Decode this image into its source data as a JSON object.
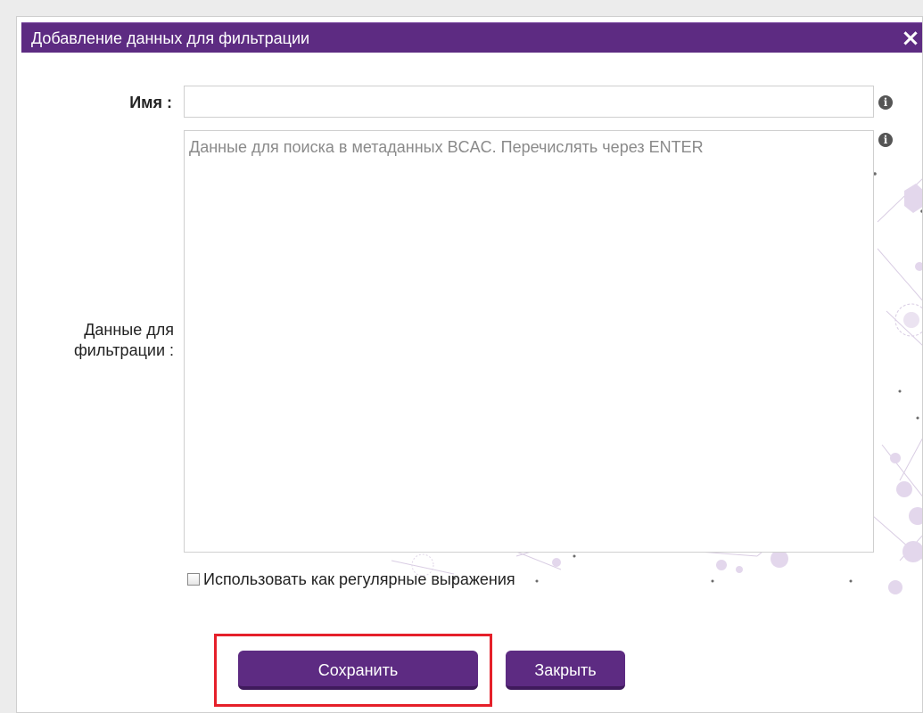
{
  "dialog": {
    "title": "Добавление данных для фильтрации",
    "close_icon": "×"
  },
  "form": {
    "name_label": "Имя :",
    "name_value": "",
    "data_label": "Данные для фильтрации :",
    "data_value": "",
    "data_placeholder": "Данные для поиска в метаданных BCAC. Перечислять через ENTER",
    "info_icon": "i",
    "regex_label": "Использовать как регулярные выражения",
    "regex_checked": false
  },
  "buttons": {
    "save_label": "Сохранить",
    "close_label": "Закрыть"
  },
  "colors": {
    "primary": "#5d2b82",
    "highlight": "#e5202a",
    "network": "#c8b6d8"
  }
}
